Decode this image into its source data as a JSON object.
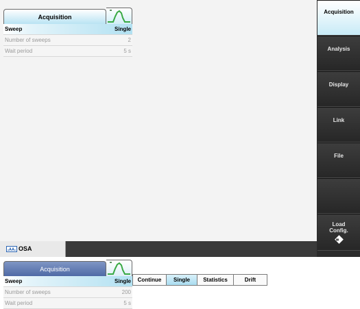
{
  "top_panel": {
    "title": "Acquisition",
    "rows": [
      {
        "label": "Sweep",
        "value": "Single"
      },
      {
        "label": "Number of sweeps",
        "value": "2"
      },
      {
        "label": "Wait period",
        "value": "5 s"
      }
    ]
  },
  "softkeys": [
    {
      "label": "Acquisition",
      "active": true
    },
    {
      "label": "Analysis",
      "active": false
    },
    {
      "label": "Display",
      "active": false
    },
    {
      "label": "Link",
      "active": false
    },
    {
      "label": "File",
      "active": false
    },
    {
      "label": "",
      "active": false
    },
    {
      "label": "Load Config.",
      "active": false,
      "icon": "diamond-navigation-icon"
    }
  ],
  "status_bar": {
    "tab_label": "OSA",
    "tab_icon": "osa-waveform-icon"
  },
  "bottom_panel": {
    "title": "Acquisition",
    "rows": [
      {
        "label": "Sweep",
        "value": "Single"
      },
      {
        "label": "Number of sweeps",
        "value": "200"
      },
      {
        "label": "Wait period",
        "value": "5 s"
      }
    ],
    "sweep_options": [
      "Continue",
      "Single",
      "Statistics",
      "Drift"
    ],
    "selected_option": "Single"
  },
  "colors": {
    "accent_light_blue": "#b9e3f3",
    "softkey_dark": "#2b2b2b",
    "bottom_title_blue": "#4f6aa6"
  }
}
